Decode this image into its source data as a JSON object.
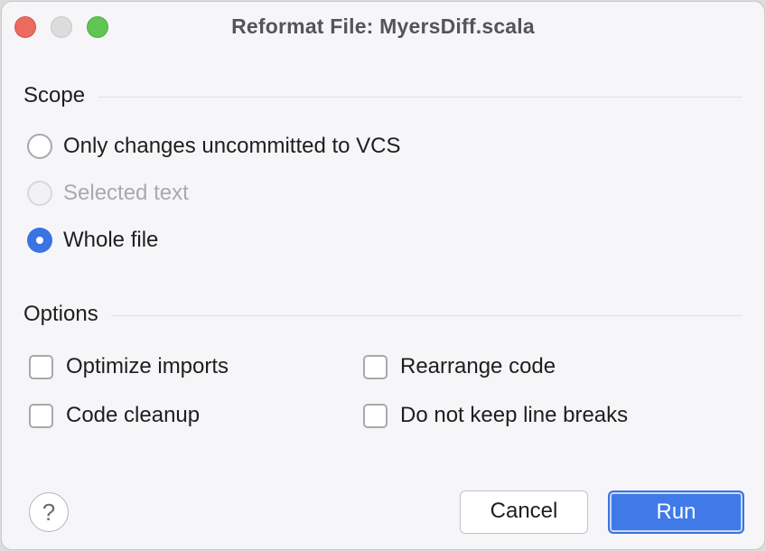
{
  "window": {
    "title": "Reformat File: MyersDiff.scala",
    "traffic_lights": [
      "close",
      "minimize",
      "maximize"
    ]
  },
  "scope": {
    "header": "Scope",
    "options": [
      {
        "label": "Only changes uncommitted to VCS",
        "selected": false,
        "enabled": true
      },
      {
        "label": "Selected text",
        "selected": false,
        "enabled": false
      },
      {
        "label": "Whole file",
        "selected": true,
        "enabled": true
      }
    ]
  },
  "options": {
    "header": "Options",
    "checkboxes": [
      {
        "label": "Optimize imports",
        "checked": false
      },
      {
        "label": "Rearrange code",
        "checked": false
      },
      {
        "label": "Code cleanup",
        "checked": false
      },
      {
        "label": "Do not keep line breaks",
        "checked": false
      }
    ]
  },
  "footer": {
    "help_glyph": "?",
    "cancel_label": "Cancel",
    "run_label": "Run"
  },
  "colors": {
    "accent": "#3b73e3",
    "close": "#ed6a5e",
    "maximize": "#61c554",
    "minimize_inactive": "#dcdcdc"
  }
}
